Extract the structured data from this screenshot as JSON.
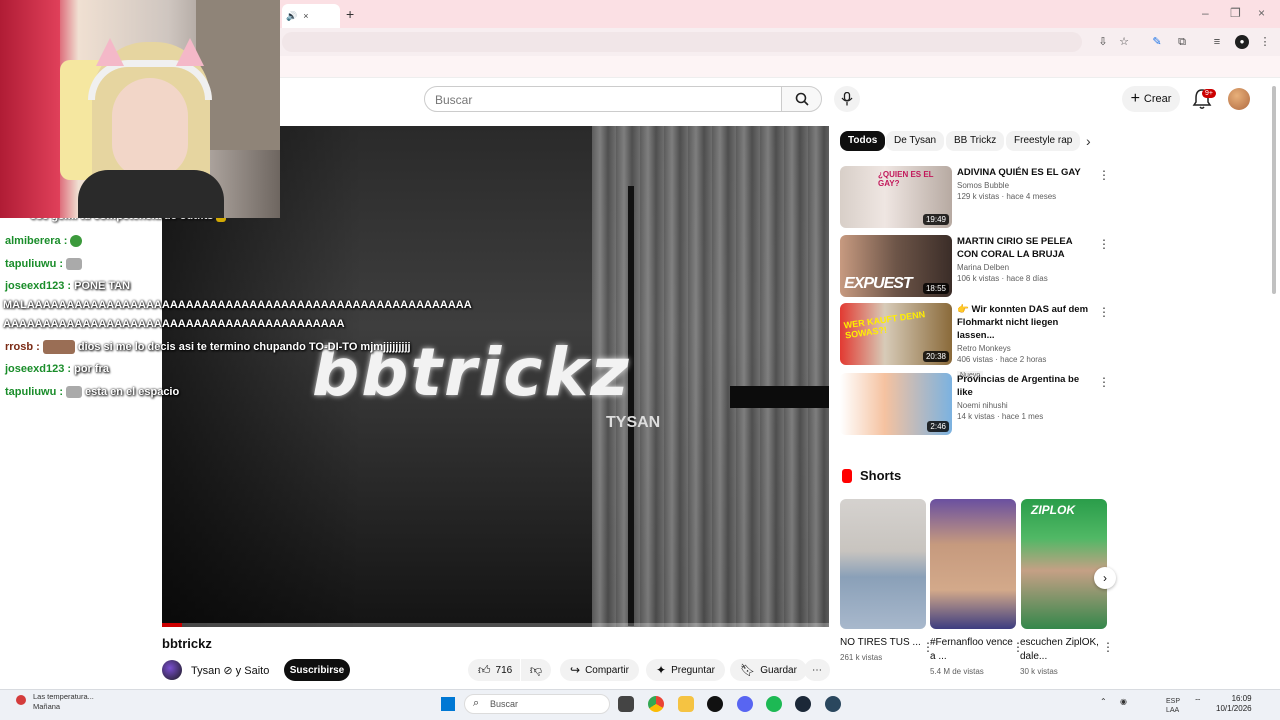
{
  "browser": {
    "tab_close": "×",
    "new_tab": "+",
    "window_controls": [
      "–",
      "❐",
      "×"
    ]
  },
  "header": {
    "search_placeholder": "Buscar",
    "create_label": "Crear",
    "notifications_badge": "9+"
  },
  "player": {
    "watermark": "bbtrickz",
    "watermark_sub": "TYSAN",
    "progress": 0.03
  },
  "chat": [
    {
      "user": "almiberera :",
      "text": "",
      "emote": "green"
    },
    {
      "user": "tapuliuwu :",
      "text": "",
      "emote": "gray"
    },
    {
      "user": "joseexd123 :",
      "text": "PONE TAN",
      "emote": ""
    },
    {
      "user": "",
      "text": "MALAAAAAAAAAAAAAAAAAAAAAAAAAAAAAAAAAAAAAAAAAAAAAAAAAAAAAAAA",
      "emote": ""
    },
    {
      "user": "",
      "text": "AAAAAAAAAAAAAAAAAAAAAAAAAAAAAAAAAAAAAAAAAAA",
      "emote": ""
    },
    {
      "user": "rrosb :",
      "text": "dios si me lo decis asi te termino chupando TO-DI-TO mjmjjjjjjjjj",
      "emote": "photo"
    },
    {
      "user": "joseexd123 :",
      "text": "por fra",
      "emote": ""
    },
    {
      "user": "tapuliuwu :",
      "text": "esta en el espacio",
      "emote": "gray"
    }
  ],
  "chat_top_partial": "ese gemi tu competencia de outfits",
  "video": {
    "title": "bbtrickz",
    "channel": "Tysan ⊘ y Saito",
    "subscribe_label": "Suscribirse",
    "likes": "716",
    "share_label": "Compartir",
    "ask_label": "Preguntar",
    "save_label": "Guardar",
    "more": "⋯"
  },
  "chips": [
    "Todos",
    "De Tysan",
    "BB Trickz",
    "Freestyle rap"
  ],
  "recommendations": [
    {
      "title": "ADIVINA QUIÉN ES EL GAY",
      "channel": "Somos Bubble",
      "stats": "129 k vistas · hace 4 meses",
      "duration": "19:49",
      "badge": "",
      "thumb_text": "¿QUIEN ES EL GAY?"
    },
    {
      "title": "MARTIN CIRIO SE PELEA CON CORAL LA BRUJA",
      "channel": "Marina Delben",
      "stats": "106 k vistas · hace 8 días",
      "duration": "18:55",
      "badge": "",
      "thumb_text": "EXPUEST"
    },
    {
      "title": "👉 Wir konnten DAS auf dem Flohmarkt nicht liegen lassen...",
      "channel": "Retro Monkeys",
      "stats": "406 vistas · hace 2 horas",
      "duration": "20:38",
      "badge": "Nuevo",
      "thumb_text": "WER KAUFT DENN SOWAS?!"
    },
    {
      "title": "Provincias de Argentina be like",
      "channel": "Noemi nihushi",
      "stats": "14 k vistas · hace 1 mes",
      "duration": "2:46",
      "badge": "",
      "thumb_text": ""
    }
  ],
  "shorts": {
    "heading": "Shorts",
    "items": [
      {
        "title": "NO TIRES TUS ...",
        "views": "261 k vistas"
      },
      {
        "title": "#Fernanfloo vence a ...",
        "views": "5.4 M de vistas"
      },
      {
        "title": "escuchen ZiplOK, dale...",
        "views": "30 k vistas",
        "brand": "ZIPLOK"
      }
    ]
  },
  "taskbar": {
    "weather_line1": "Las temperatura...",
    "weather_line2": "Mañana",
    "search_placeholder": "Buscar",
    "lang_line1": "ESP",
    "lang_line2": "LAA",
    "time": "16:09",
    "date": "10/1/2026"
  }
}
